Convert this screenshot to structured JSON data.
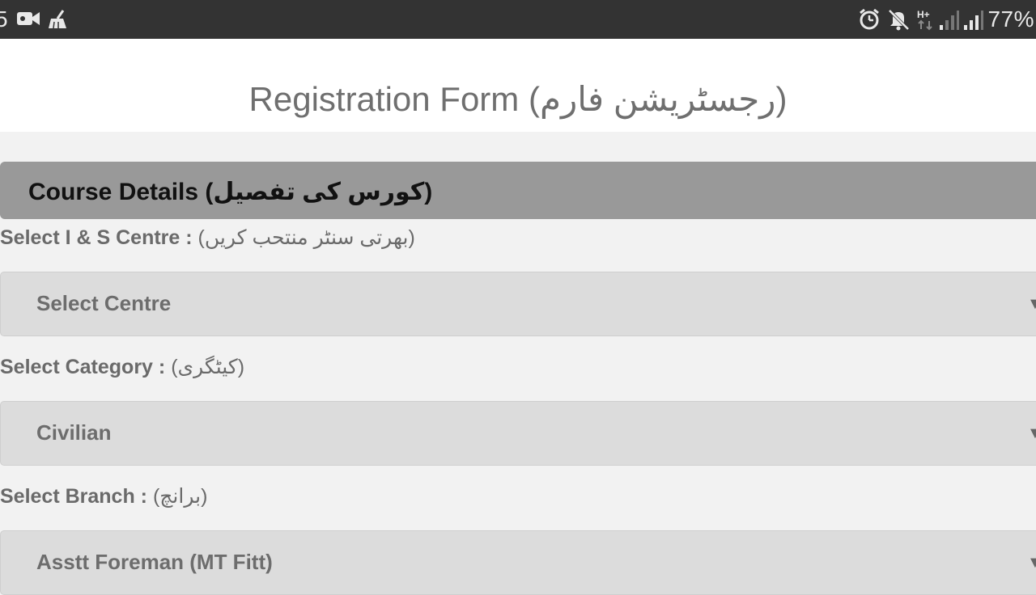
{
  "status_bar": {
    "time_fragment": "5",
    "icons": [
      "video-camera-icon",
      "broom-icon",
      "alarm-icon",
      "mute-icon",
      "hplus-network-icon",
      "signal-weak-icon",
      "signal-icon"
    ],
    "network_label": "H+",
    "battery": "77%"
  },
  "header": {
    "title": "Registration Form (رجسٹریشن فارم)"
  },
  "section": {
    "title": "Course Details (کورس کی تفصیل)"
  },
  "fields": [
    {
      "label": "Select I & S Centre :",
      "label_urdu": "(بھرتی سنٹر منتحب کریں)",
      "value": "Select Centre"
    },
    {
      "label": "Select Category :",
      "label_urdu": "(کیٹگری)",
      "value": "Civilian"
    },
    {
      "label": "Select Branch :",
      "label_urdu": "(برانچ)",
      "value": "Asstt Foreman (MT Fitt)"
    }
  ],
  "colors": {
    "status_bar": "#333333",
    "header_bg": "#ffffff",
    "section_bar": "#999999",
    "select_bg": "#dcdcdc",
    "page_bg": "#f2f2f2"
  }
}
